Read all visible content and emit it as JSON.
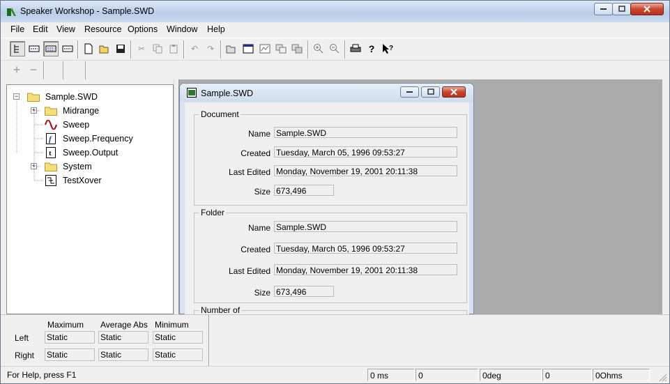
{
  "window": {
    "title": "Speaker Workshop - Sample.SWD"
  },
  "menu": [
    "File",
    "Edit",
    "View",
    "Resource",
    "Options",
    "Window",
    "Help"
  ],
  "tree": {
    "root": "Sample.SWD",
    "items": [
      {
        "label": "Midrange",
        "icon": "folder-icon",
        "expandable": true
      },
      {
        "label": "Sweep",
        "icon": "sweep-wave-icon",
        "expandable": false
      },
      {
        "label": "Sweep.Frequency",
        "icon": "frequency-f-icon",
        "expandable": false
      },
      {
        "label": "Sweep.Output",
        "icon": "output-t-icon",
        "expandable": false
      },
      {
        "label": "System",
        "icon": "folder-icon",
        "expandable": true
      },
      {
        "label": "TestXover",
        "icon": "crossover-icon",
        "expandable": false
      }
    ]
  },
  "child": {
    "title": "Sample.SWD",
    "document": {
      "legend": "Document",
      "name_label": "Name",
      "name": "Sample.SWD",
      "created_label": "Created",
      "created": "Tuesday, March 05, 1996 09:53:27",
      "edited_label": "Last Edited",
      "edited": "Monday, November 19, 2001 20:11:38",
      "size_label": "Size",
      "size": "673,496"
    },
    "folder": {
      "legend": "Folder",
      "name_label": "Name",
      "name": "Sample.SWD",
      "created_label": "Created",
      "created": "Tuesday, March 05, 1996 09:53:27",
      "edited_label": "Last Edited",
      "edited": "Monday, November 19, 2001 20:11:38",
      "size_label": "Size",
      "size": "673,496"
    },
    "number_legend": "Number of"
  },
  "stats": {
    "headers": [
      "Maximum",
      "Average Abs",
      "Minimum"
    ],
    "rows": [
      {
        "label": "Left",
        "values": [
          "Static",
          "Static",
          "Static"
        ]
      },
      {
        "label": "Right",
        "values": [
          "Static",
          "Static",
          "Static"
        ]
      }
    ]
  },
  "status": {
    "help": "For Help, press F1",
    "cells": [
      "0 ms",
      "0",
      "0deg",
      "0",
      "0Ohms"
    ]
  }
}
